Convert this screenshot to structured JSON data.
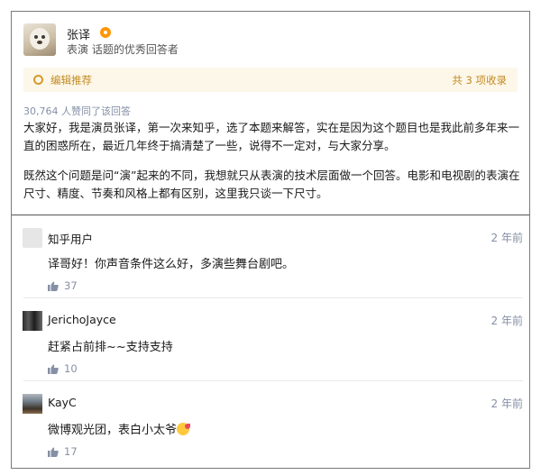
{
  "answer": {
    "author_name": "张译",
    "author_desc": "表演 话题的优秀回答者",
    "recommend_label": "编辑推荐",
    "recommend_count": "共 3 项收录",
    "vote_summary": "30,764 人赞同了该回答",
    "paragraph_1": "大家好，我是演员张译，第一次来知乎，选了本题来解答，实在是因为这个题目也是我此前多年来一直的困惑所在，最近几年终于搞清楚了一些，说得不一定对，与大家分享。",
    "paragraph_2": "既然这个问题是问“演”起来的不同，我想就只从表演的技术层面做一个回答。电影和电视剧的表演在尺寸、精度、节奏和风格上都有区别，这里我只谈一下尺寸。"
  },
  "comments": [
    {
      "user": "知乎用户",
      "time": "2 年前",
      "text": "译哥好！你声音条件这么好，多演些舞台剧吧。",
      "likes": "37"
    },
    {
      "user": "JerichoJayce",
      "time": "2 年前",
      "text": "赶紧占前排~~支持支持",
      "likes": "10"
    },
    {
      "user": "KayC",
      "time": "2 年前",
      "text": "微博观光团，表白小太爷",
      "likes": "17"
    }
  ],
  "icons": {
    "badge": "orange-badge-icon",
    "recommend": "ring-icon",
    "like": "thumbs-up-icon",
    "emoji": "blush-kiss-emoji-icon"
  },
  "colors": {
    "accent_gold": "#c28b21",
    "badge_orange": "#ff9607",
    "meta_gray": "#8590a6",
    "recommend_bg": "#fdf7ea"
  }
}
